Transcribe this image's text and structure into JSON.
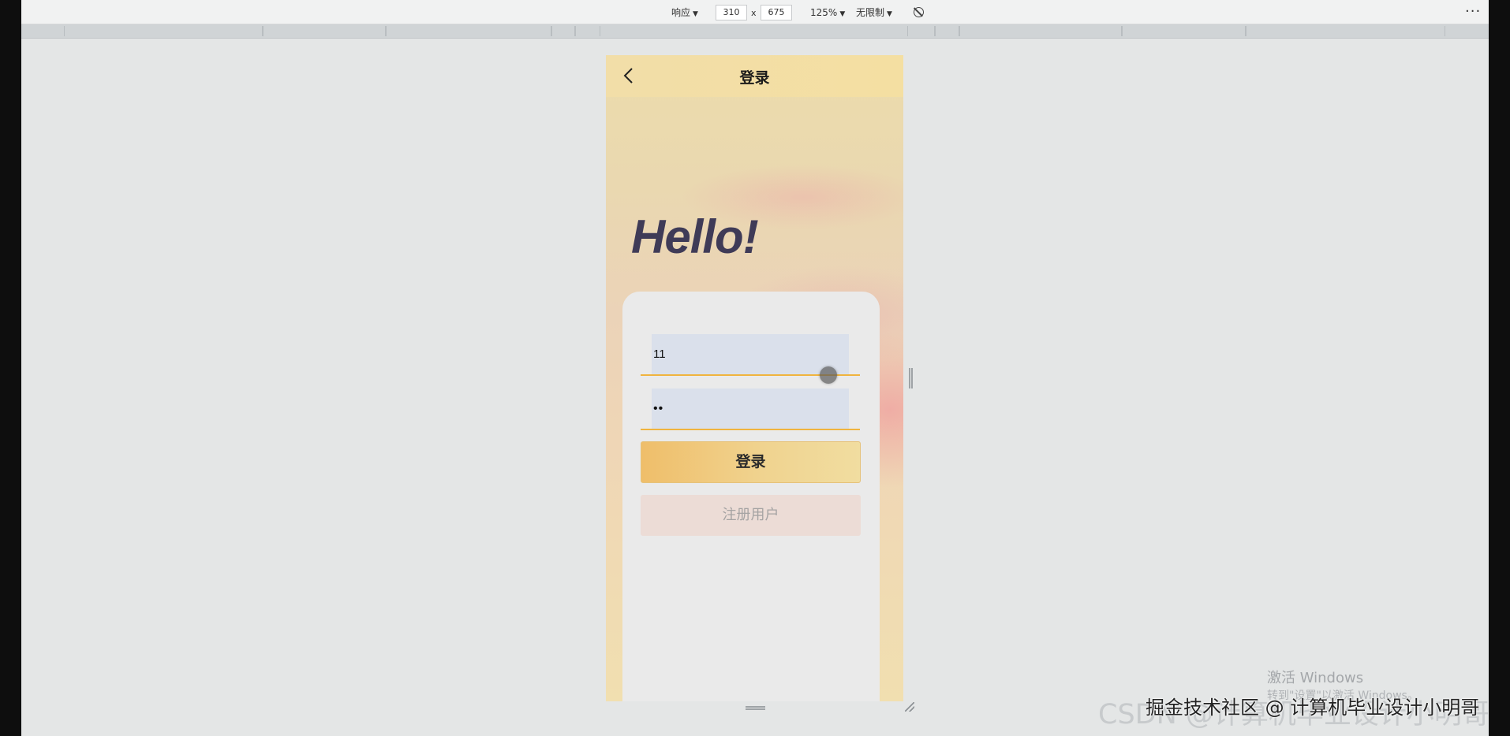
{
  "devtools": {
    "device_mode": "响应",
    "width": "310",
    "times": "x",
    "height": "675",
    "zoom": "125%",
    "throttle": "无限制",
    "more": "···"
  },
  "phone": {
    "header_title": "登录",
    "greeting": "Hello!",
    "username_value": "11",
    "password_value": "••",
    "login_label": "登录",
    "register_label": "注册用户"
  },
  "watermarks": {
    "windows_activate": "激活 Windows",
    "windows_hint": "转到\"设置\"以激活 Windows。",
    "csdn": "CSDN @计算机毕业设计小明哥",
    "juejin": "掘金技术社区 @ 计算机毕业设计小明哥"
  },
  "colors": {
    "accent": "#f0b43e",
    "header_bg": "#f3dfa5",
    "login_button": "#efc374",
    "register_button": "#ecdcd6",
    "greeting_text": "#3f3b57",
    "field_bg": "#dae0eb"
  },
  "icons": {
    "back": "chevron-left-icon",
    "rotate": "rotate-disabled-icon",
    "more": "more-dots-icon"
  }
}
